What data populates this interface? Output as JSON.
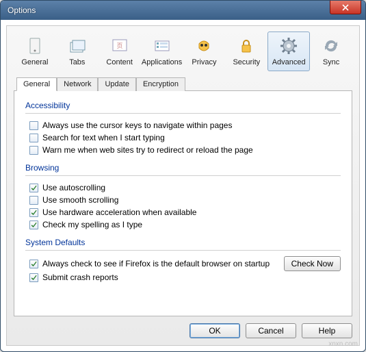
{
  "window": {
    "title": "Options"
  },
  "toolbar": {
    "items": [
      {
        "label": "General"
      },
      {
        "label": "Tabs"
      },
      {
        "label": "Content"
      },
      {
        "label": "Applications"
      },
      {
        "label": "Privacy"
      },
      {
        "label": "Security"
      },
      {
        "label": "Advanced"
      },
      {
        "label": "Sync"
      }
    ],
    "active": 6
  },
  "subtabs": {
    "items": [
      {
        "label": "General"
      },
      {
        "label": "Network"
      },
      {
        "label": "Update"
      },
      {
        "label": "Encryption"
      }
    ],
    "active": 0
  },
  "groups": {
    "accessibility": {
      "title": "Accessibility",
      "items": [
        {
          "label": "Always use the cursor keys to navigate within pages",
          "checked": false
        },
        {
          "label": "Search for text when I start typing",
          "checked": false
        },
        {
          "label": "Warn me when web sites try to redirect or reload the page",
          "checked": false
        }
      ]
    },
    "browsing": {
      "title": "Browsing",
      "items": [
        {
          "label": "Use autoscrolling",
          "checked": true
        },
        {
          "label": "Use smooth scrolling",
          "checked": false
        },
        {
          "label": "Use hardware acceleration when available",
          "checked": true
        },
        {
          "label": "Check my spelling as I type",
          "checked": true
        }
      ]
    },
    "defaults": {
      "title": "System Defaults",
      "items": [
        {
          "label": "Always check to see if Firefox is the default browser on startup",
          "checked": true
        },
        {
          "label": "Submit crash reports",
          "checked": true
        }
      ],
      "check_now": "Check Now"
    }
  },
  "buttons": {
    "ok": "OK",
    "cancel": "Cancel",
    "help": "Help"
  },
  "watermark": "xnxn.com"
}
